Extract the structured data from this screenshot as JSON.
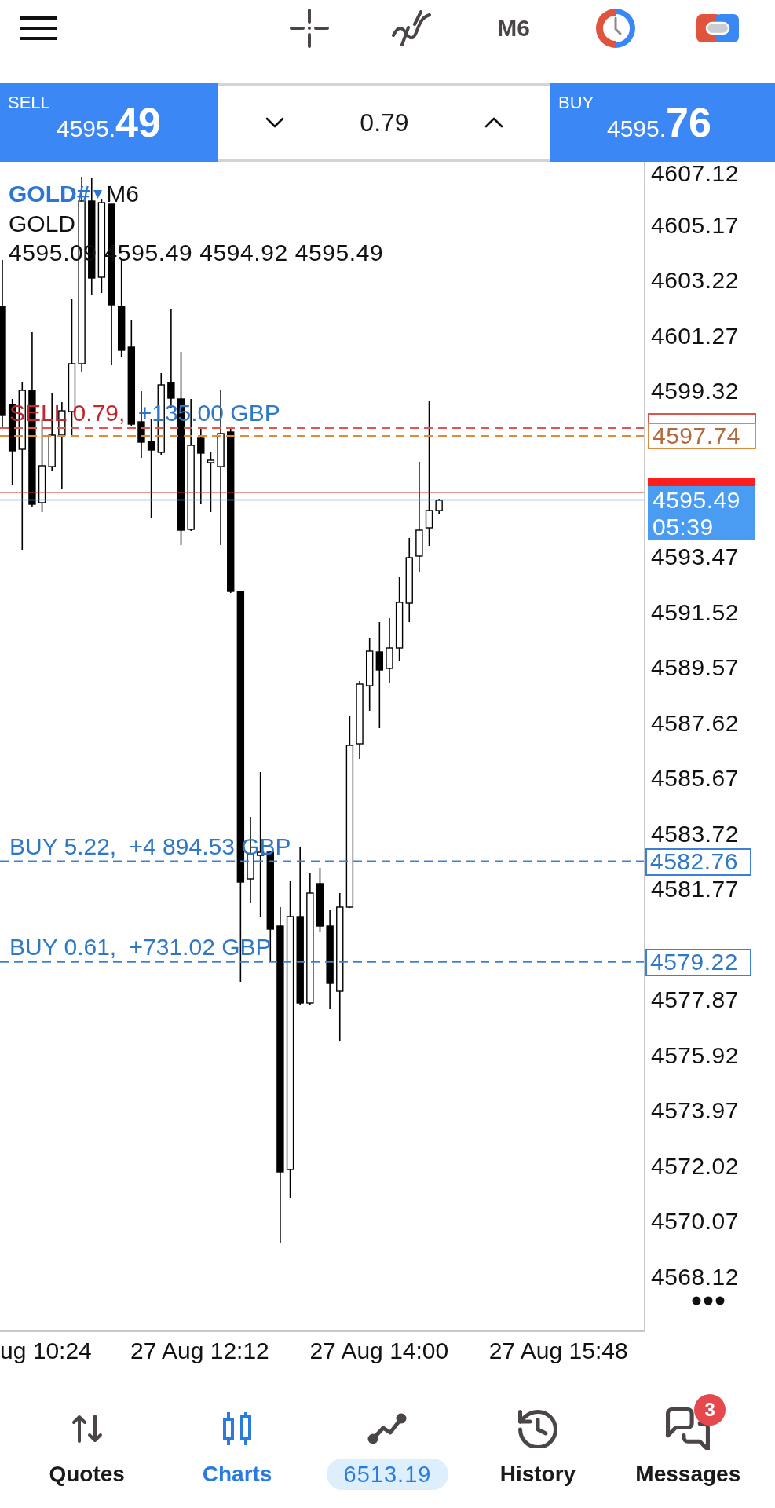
{
  "toolbar": {
    "timeframe": "M6"
  },
  "trade_bar": {
    "sell": {
      "label": "SELL",
      "price": "4595.",
      "price_big": "49"
    },
    "volume": "0.79",
    "buy": {
      "label": "BUY",
      "price": "4595.",
      "price_big": "76"
    }
  },
  "chart": {
    "symbol": "GOLD#",
    "timeframe": "M6",
    "description": "GOLD",
    "ohlc": "4595.09 4595.49 4594.92 4595.49",
    "price_axis": [
      "4607.12",
      "4605.17",
      "4603.22",
      "4601.27",
      "4599.32",
      "4593.47",
      "4591.52",
      "4589.57",
      "4587.62",
      "4585.67",
      "4583.72",
      "4581.77",
      "4577.87",
      "4575.92",
      "4573.97",
      "4572.02",
      "4570.07",
      "4568.12"
    ],
    "positions": [
      {
        "kind": "sell",
        "label": "SELL 0.79,",
        "profit": "+135.00 GBP"
      },
      {
        "kind": "buy",
        "label": "BUY 5.22,",
        "profit": "+4 894.53 GBP",
        "price": "4582.76"
      },
      {
        "kind": "buy",
        "label": "BUY 0.61,",
        "profit": "+731.02 GBP",
        "price": "4579.22"
      }
    ],
    "levels": [
      {
        "kind": "order",
        "price": "4597.74"
      }
    ],
    "current_price": {
      "bid": "4595.49",
      "countdown": "05:39"
    },
    "time_axis": [
      "ug 10:24",
      "27 Aug 12:12",
      "27 Aug 14:00",
      "27 Aug 15:48"
    ]
  },
  "nav": [
    {
      "kind": "tab",
      "label": "Quotes",
      "selected": false
    },
    {
      "kind": "tab",
      "label": "Charts",
      "selected": true
    },
    {
      "kind": "balance",
      "label": "6513.19",
      "selected": false
    },
    {
      "kind": "tab",
      "label": "History",
      "selected": false
    },
    {
      "kind": "tab",
      "label": "Messages",
      "selected": false,
      "badge": "3"
    }
  ]
}
